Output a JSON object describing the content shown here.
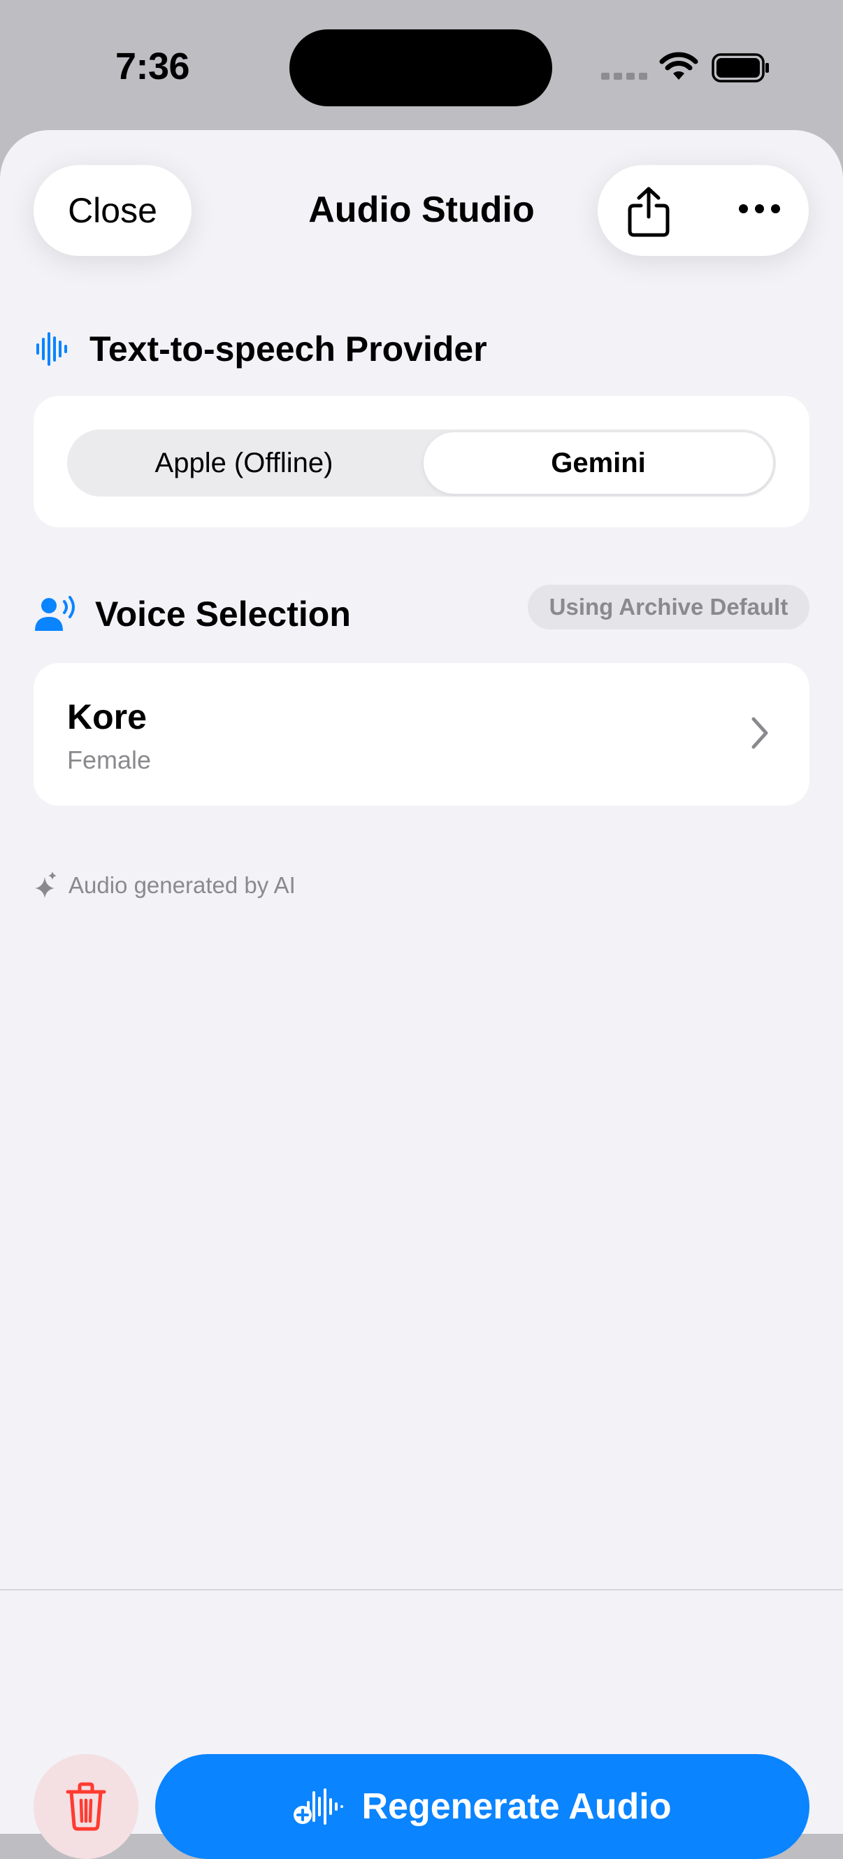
{
  "status_bar": {
    "time": "7:36"
  },
  "header": {
    "close_label": "Close",
    "title": "Audio Studio"
  },
  "provider_section": {
    "title": "Text-to-speech Provider",
    "options": [
      "Apple (Offline)",
      "Gemini"
    ],
    "selected": "Gemini"
  },
  "voice_section": {
    "title": "Voice Selection",
    "badge": "Using Archive Default",
    "voice_name": "Kore",
    "voice_gender": "Female"
  },
  "ai_note": "Audio generated by AI",
  "footer": {
    "regenerate_label": "Regenerate Audio"
  },
  "colors": {
    "accent": "#0a84ff",
    "destructive": "#ff3b30",
    "destructive_bg": "#f4dfe2",
    "background": "#f2f2f7"
  }
}
